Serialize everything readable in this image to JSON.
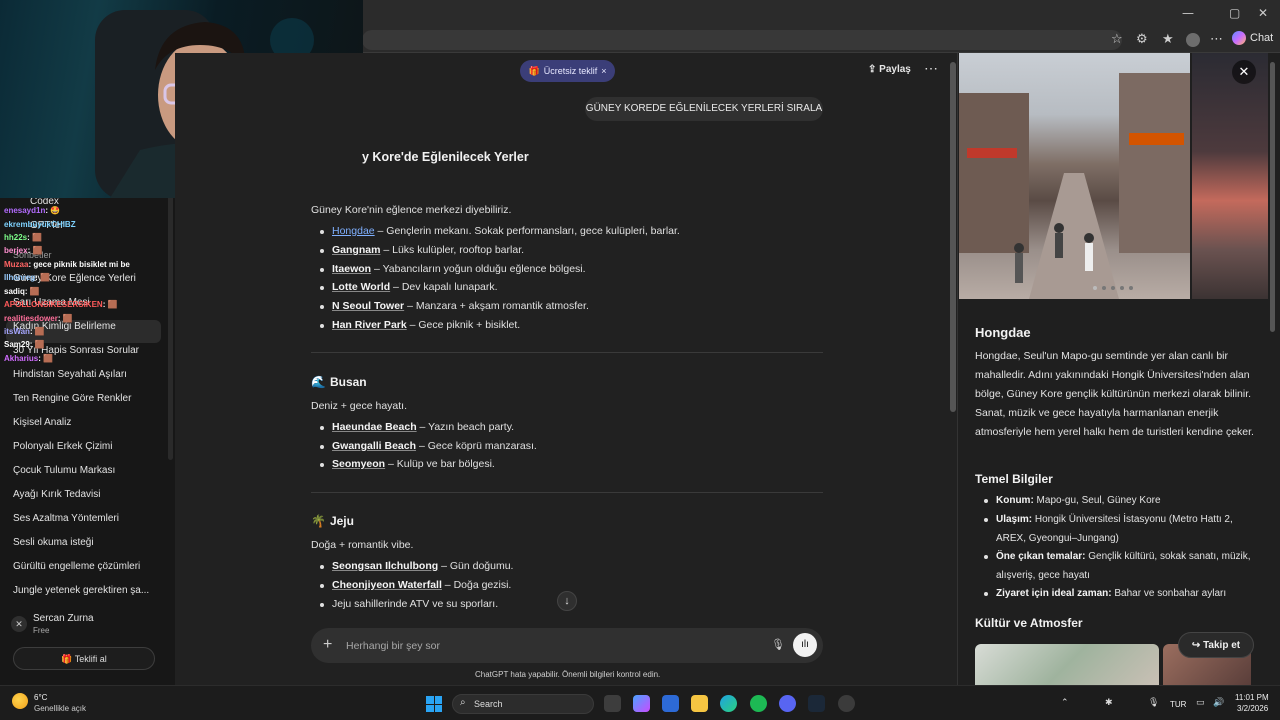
{
  "browser": {
    "chat_label": "Chat",
    "window_controls": [
      "—",
      "▢",
      "✕"
    ]
  },
  "sidebar": {
    "codex_label": "Codex",
    "gpts_label": "GPT'ler",
    "section_label": "Sohbetler",
    "items": [
      "Güney Kore Eğlence Yerleri",
      "Sarı Uzama Mesi",
      "Kadın Kimliği Belirleme",
      "30 Yıl Hapis Sonrası Sorular",
      "Hindistan Seyahati Aşıları",
      "Ten Rengine Göre Renkler",
      "Kişisel Analiz",
      "Polonyalı Erkek Çizimi",
      "Çocuk Tulumu Markası",
      "Ayağı Kırık Tedavisi",
      "Ses Azaltma Yöntemleri",
      "Sesli okuma isteği",
      "Gürültü engelleme çözümleri",
      "Jungle yetenek gerektiren şa..."
    ],
    "user_name": "Sercan Zurna",
    "user_plan": "Free",
    "offer_button": "Teklifi al"
  },
  "twitch_chat": [
    {
      "user": "enesayd1n",
      "msg": ": 🤩",
      "color": "#b36cff"
    },
    {
      "user": "ekrembüyükCHIBZ",
      "msg": "",
      "color": "#7fd3ff"
    },
    {
      "user": "hh22s",
      "msg": ": 🟫",
      "color": "#7dff8a"
    },
    {
      "user": "berjex",
      "msg": ": 🟫",
      "color": "#ff8fd0"
    },
    {
      "user": "Muzaa",
      "msg": ": gece piknik bisiklet mi be",
      "color": "#ff6464"
    },
    {
      "user": "Ilhanreg",
      "msg": ": 🟫",
      "color": "#9cf"
    },
    {
      "user": "sadiq",
      "msg": ": 🟫",
      "color": "#fff"
    },
    {
      "user": "APOLLONSIKESERSIKEN",
      "msg": ": 🟫",
      "color": "#ff5a5a"
    },
    {
      "user": "realitiesdower",
      "msg": ": 🟫",
      "color": "#ff6f9b"
    },
    {
      "user": "itsWan",
      "msg": ": 🟫",
      "color": "#a6a6ff"
    },
    {
      "user": "Sam29",
      "msg": ": 🟫",
      "color": "#fff"
    },
    {
      "user": "Akharius",
      "msg": ": 🟫",
      "color": "#d06cff"
    }
  ],
  "main": {
    "offer_pill": "Ücretsiz teklif",
    "share_label": "Paylaş",
    "more_label": "⋯",
    "user_message": "GÜNEY KOREDE EĞLENİLECEK YERLERİ SIRALA",
    "heading": "y Kore'de Eğlenilecek Yerler",
    "intro": "Güney Kore'nin eğlence merkezi diyebiliriz.",
    "seoul_items": [
      {
        "name": "Hongdae",
        "desc": " – Gençlerin mekanı. Sokak performansları, gece kulüpleri, barlar."
      },
      {
        "name": "Gangnam",
        "desc": " – Lüks kulüpler, rooftop barlar."
      },
      {
        "name": "Itaewon",
        "desc": " – Yabancıların yoğun olduğu eğlence bölgesi."
      },
      {
        "name": "Lotte World",
        "desc": " – Dev kapalı lunapark."
      },
      {
        "name": "N Seoul Tower",
        "desc": " – Manzara + akşam romantik atmosfer."
      },
      {
        "name": "Han River Park",
        "desc": " – Gece piknik + bisiklet."
      }
    ],
    "busan_emoji": "🌊",
    "busan_title": "Busan",
    "busan_intro": "Deniz + gece hayatı.",
    "busan_items": [
      {
        "name": "Haeundae Beach",
        "desc": " – Yazın beach party."
      },
      {
        "name": "Gwangalli Beach",
        "desc": " – Gece köprü manzarası."
      },
      {
        "name": "Seomyeon",
        "desc": " – Kulüp ve bar bölgesi."
      }
    ],
    "jeju_emoji": "🌴",
    "jeju_title": "Jeju",
    "jeju_intro": "Doğa + romantik vibe.",
    "jeju_items": [
      {
        "name": "Seongsan Ilchulbong",
        "desc": " – Gün doğumu."
      },
      {
        "name": "Cheonjiyeon Waterfall",
        "desc": " – Doğa gezisi."
      },
      {
        "name": "",
        "desc": "Jeju sahillerinde ATV ve su sporları."
      }
    ],
    "composer_placeholder": "Herhangi bir şey sor",
    "disclaimer": "ChatGPT hata yapabilir. Önemli bilgileri kontrol edin."
  },
  "panel": {
    "title": "Hongdae",
    "description": "Hongdae, Seul'un Mapo-gu semtinde yer alan canlı bir mahalledir. Adını yakınındaki Hongik Üniversitesi'nden alan bölge, Güney Kore gençlik kültürünün merkezi olarak bilinir. Sanat, müzik ve gece hayatıyla harmanlanan enerjik atmosferiyle hem yerel halkı hem de turistleri kendine çeker.",
    "facts_title": "Temel Bilgiler",
    "facts": [
      {
        "label": "Konum:",
        "value": " Mapo-gu, Seul, Güney Kore"
      },
      {
        "label": "Ulaşım:",
        "value": " Hongik Üniversitesi İstasyonu (Metro Hattı 2, AREX, Gyeongui–Jungang)"
      },
      {
        "label": "Öne çıkan temalar:",
        "value": " Gençlik kültürü, sokak sanatı, müzik, alışveriş, gece hayatı"
      },
      {
        "label": "Ziyaret için ideal zaman:",
        "value": " Bahar ve sonbahar ayları"
      }
    ],
    "culture_title": "Kültür ve Atmosfer",
    "follow_label": "Takip et"
  },
  "taskbar": {
    "weather_temp": "6°C",
    "weather_desc": "Genellikle açık",
    "search_label": "Search",
    "lang": "TUR",
    "time": "11:01 PM",
    "date": "3/2/2026"
  },
  "colors": {
    "accent_link": "#7fb0ff",
    "offer_pill": "#3b3e78"
  }
}
